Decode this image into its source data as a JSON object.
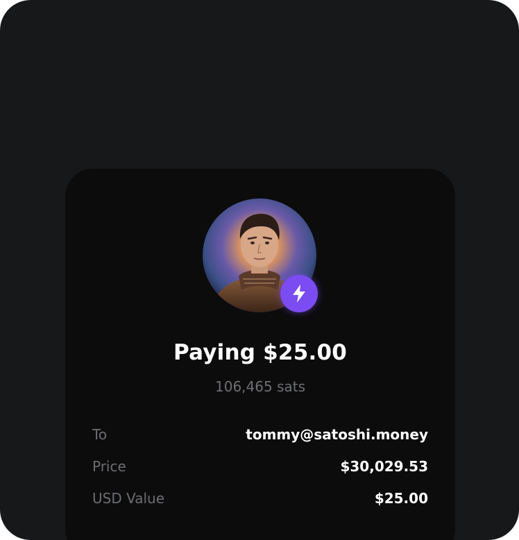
{
  "payment": {
    "title": "Paying $25.00",
    "sats": "106,465 sats"
  },
  "details": [
    {
      "label": "To",
      "value": "tommy@satoshi.money"
    },
    {
      "label": "Price",
      "value": "$30,029.53"
    },
    {
      "label": "USD Value",
      "value": "$25.00"
    }
  ],
  "icons": {
    "badge": "lightning-bolt-icon"
  },
  "colors": {
    "background": "#17181a",
    "card": "#0c0c0d",
    "accent": "#7b4cf1",
    "text_primary": "#ffffff",
    "text_secondary": "#6d6e72"
  }
}
